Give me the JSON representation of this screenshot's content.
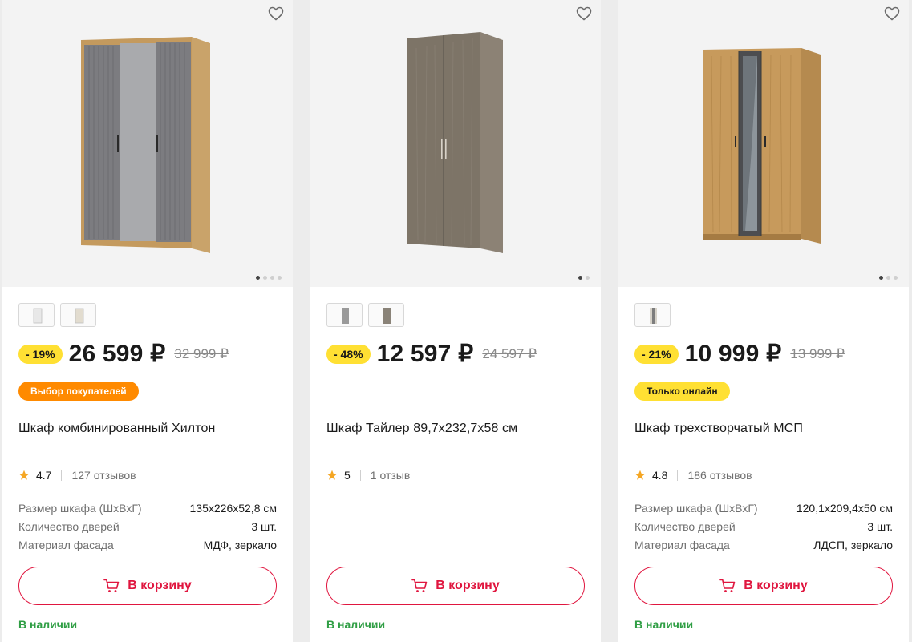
{
  "products": [
    {
      "discount": "- 19%",
      "price": "26 599 ₽",
      "old_price": "32 999 ₽",
      "badge": "Выбор покупателей",
      "title": "Шкаф комбинированный Хилтон",
      "rating": "4.7",
      "reviews": "127 отзывов",
      "specs": [
        {
          "k": "Размер шкафа (ШхВхГ)",
          "v": "135x226x52,8 см"
        },
        {
          "k": "Количество дверей",
          "v": "3 шт."
        },
        {
          "k": "Материал фасада",
          "v": "МДФ, зеркало"
        }
      ],
      "cart_label": "В корзину",
      "stock": "В наличии",
      "image_icon": "wardrobe-gray-mirror-image",
      "dots_active": 0
    },
    {
      "discount": "- 48%",
      "price": "12 597 ₽",
      "old_price": "24 597 ₽",
      "title": "Шкаф Тайлер 89,7x232,7x58 см",
      "rating": "5",
      "reviews": "1 отзыв",
      "cart_label": "В корзину",
      "stock": "В наличии",
      "image_icon": "wardrobe-gray-oak-image",
      "dots_active": 0
    },
    {
      "discount": "- 21%",
      "price": "10 999 ₽",
      "old_price": "13 999 ₽",
      "badge": "Только онлайн",
      "title": "Шкаф трехстворчатый МСП",
      "rating": "4.8",
      "reviews": "186 отзывов",
      "specs": [
        {
          "k": "Размер шкафа (ШхВхГ)",
          "v": "120,1x209,4x50 см"
        },
        {
          "k": "Количество дверей",
          "v": "3 шт."
        },
        {
          "k": "Материал фасада",
          "v": "ЛДСП, зеркало"
        }
      ],
      "cart_label": "В корзину",
      "stock": "В наличии",
      "image_icon": "wardrobe-oak-mirror-image",
      "dots_active": 0
    }
  ],
  "colors": {
    "accent": "#e0163f",
    "discount_badge": "#ffe033",
    "choice_badge": "#ff8a00",
    "in_stock": "#2f9e44",
    "star": "#f5a623"
  }
}
